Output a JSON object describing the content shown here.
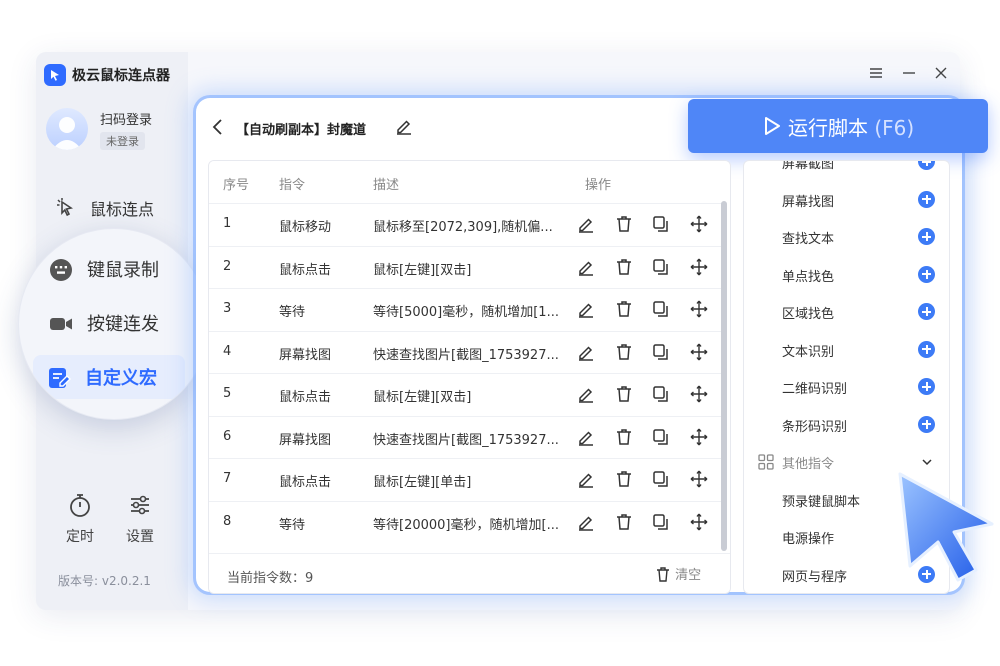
{
  "app": {
    "title": "极云鼠标连点器",
    "version": "版本号: v2.0.2.1"
  },
  "user": {
    "login_label": "扫码登录",
    "status": "未登录"
  },
  "nav": [
    {
      "label": "鼠标连点",
      "icon": "pointer-click-icon"
    },
    {
      "label": "键鼠录制",
      "icon": "keyboard-record-icon"
    },
    {
      "label": "按键连发",
      "icon": "camera-icon"
    },
    {
      "label": "自定义宏",
      "icon": "macro-edit-icon",
      "active": true
    }
  ],
  "bottom_tools": [
    {
      "label": "定时",
      "icon": "timer-icon"
    },
    {
      "label": "设置",
      "icon": "settings-sliders-icon"
    }
  ],
  "script": {
    "title": "【自动刷副本】封魔道"
  },
  "run_button": {
    "label": "运行脚本",
    "key": "(F6)"
  },
  "table": {
    "headers": [
      "序号",
      "指令",
      "描述",
      "操作"
    ],
    "rows": [
      {
        "idx": "1",
        "cmd": "鼠标移动",
        "desc": "鼠标移至[2072,309],随机偏..."
      },
      {
        "idx": "2",
        "cmd": "鼠标点击",
        "desc": "鼠标[左键][双击]"
      },
      {
        "idx": "3",
        "cmd": "等待",
        "desc": "等待[5000]毫秒，随机增加[1..."
      },
      {
        "idx": "4",
        "cmd": "屏幕找图",
        "desc": "快速查找图片[截图_1753927..."
      },
      {
        "idx": "5",
        "cmd": "鼠标点击",
        "desc": "鼠标[左键][双击]"
      },
      {
        "idx": "6",
        "cmd": "屏幕找图",
        "desc": "快速查找图片[截图_1753927..."
      },
      {
        "idx": "7",
        "cmd": "鼠标点击",
        "desc": "鼠标[左键][单击]"
      },
      {
        "idx": "8",
        "cmd": "等待",
        "desc": "等待[20000]毫秒，随机增加[..."
      }
    ],
    "footer_count": "当前指令数：9",
    "clear_label": "清空"
  },
  "commands": {
    "items": [
      "屏幕截图",
      "屏幕找图",
      "查找文本",
      "单点找色",
      "区域找色",
      "文本识别",
      "二维码识别",
      "条形码识别"
    ],
    "other_category": "其他指令",
    "other_items": [
      "预录键鼠脚本",
      "电源操作",
      "网页与程序"
    ]
  },
  "colors": {
    "accent": "#2f6bff",
    "run_button": "#4f86f7",
    "glow": "#78aaff"
  }
}
